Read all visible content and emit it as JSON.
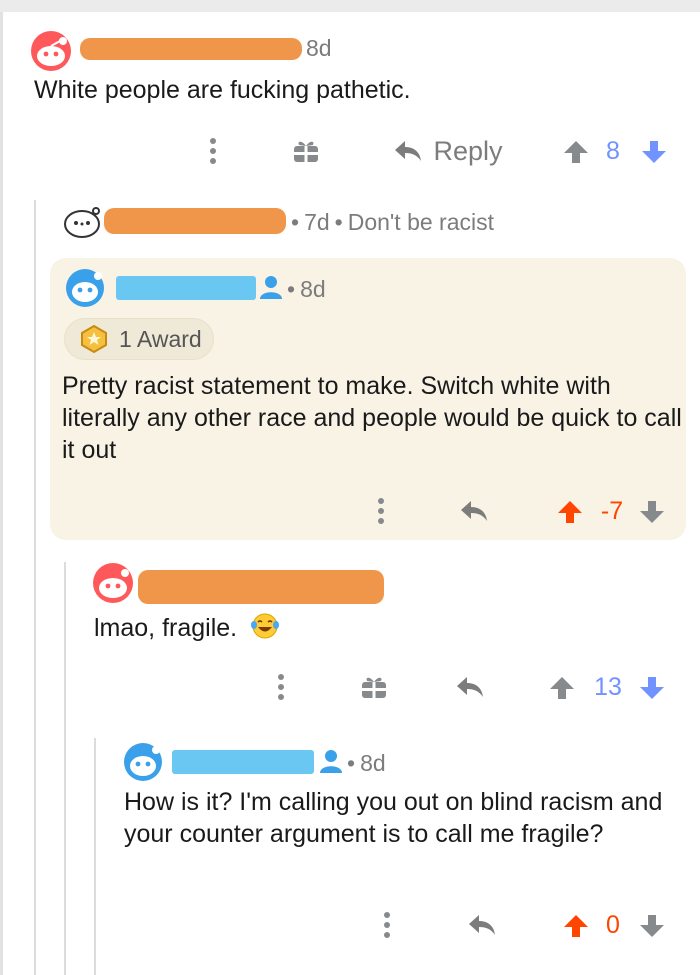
{
  "comments": [
    {
      "time": "8d",
      "body": "White people are fucking pathetic.",
      "reply_label": "Reply",
      "score": "8",
      "collapsed_note": {
        "time": "7d",
        "removed": "Don't be racist"
      }
    },
    {
      "time": "8d",
      "award_label": "1 Award",
      "body": "Pretty racist statement to make. Switch white with literally any other race and people would be quick to call it out",
      "score": "-7"
    },
    {
      "body": "lmao, fragile.",
      "score": "13"
    },
    {
      "time": "8d",
      "body": "How is it? I'm calling you out on blind racism and your counter argument is to call me fragile?",
      "score": "0"
    }
  ],
  "colors": {
    "upvote_active": "#ff4500",
    "downvote": "#7193ff",
    "score_blue": "#7193ff",
    "highlight_bg": "#f8f3e5",
    "redaction_orange": "#f0964a",
    "redaction_blue": "#69c7f2",
    "op_user_icon": "#3aa0ea"
  },
  "icons": {
    "more": "vertical-dots-icon",
    "gift": "gift-icon",
    "reply": "reply-arrow-icon",
    "upvote": "upvote-arrow-icon",
    "downvote": "downvote-arrow-icon",
    "award": "award-badge-icon",
    "emoji": "laughing-crying-emoji-icon",
    "op": "user-icon"
  }
}
